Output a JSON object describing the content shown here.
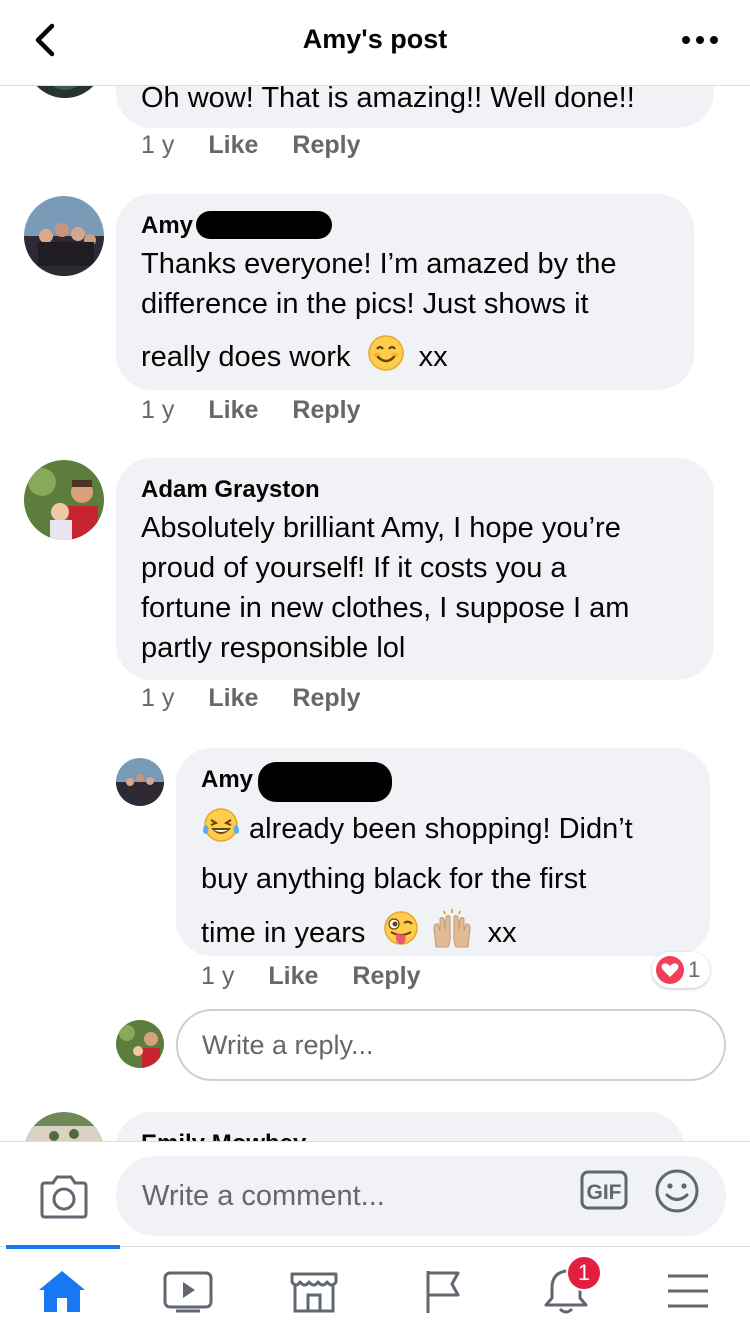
{
  "header": {
    "title": "Amy's post"
  },
  "comments": [
    {
      "text": "Oh wow! That is amazing!! Well done!!",
      "time": "1 y",
      "like": "Like",
      "reply": "Reply"
    },
    {
      "author": "Amy",
      "lines": [
        "Thanks everyone! I’m amazed by the",
        "difference in the pics! Just shows it",
        "really does work",
        "xx"
      ],
      "time": "1 y",
      "like": "Like",
      "reply": "Reply"
    },
    {
      "author": "Adam Grayston",
      "lines": [
        "Absolutely brilliant Amy, I hope you’re",
        "proud of yourself! If it costs you a",
        "fortune in new clothes, I suppose I am",
        "partly responsible lol"
      ],
      "time": "1 y",
      "like": "Like",
      "reply": "Reply"
    },
    {
      "author": "Amy",
      "lines": [
        "already been shopping! Didn’t",
        "buy anything black for the first",
        "time in years",
        "xx"
      ],
      "time": "1 y",
      "like": "Like",
      "reply": "Reply",
      "reaction_count": "1"
    },
    {
      "author": "Emily Mowbey"
    }
  ],
  "reply_input": {
    "placeholder": "Write a reply..."
  },
  "composer": {
    "placeholder": "Write a comment...",
    "gif_label": "GIF"
  },
  "tabbar": {
    "notifications_badge": "1",
    "active_color": "#1877f2"
  }
}
